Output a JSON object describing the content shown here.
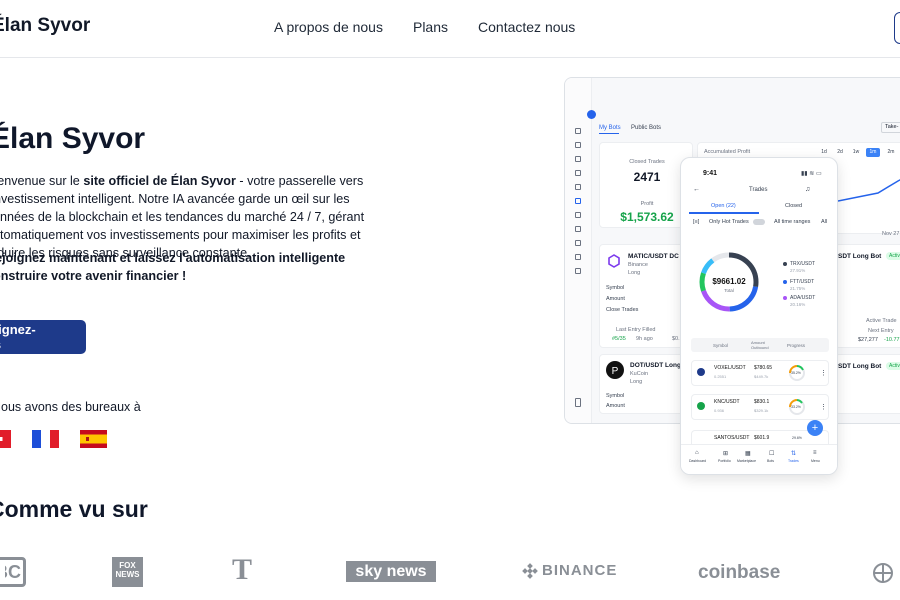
{
  "header": {
    "brand": "Élan Syvor",
    "nav": [
      "A propos de nous",
      "Plans",
      "Contactez nous"
    ]
  },
  "hero": {
    "title": "Élan Syvor",
    "desc_pre": "Bienvenue sur le ",
    "desc_bold": "site officiel de Élan Syvor",
    "desc_post": " - votre passerelle vers l'investissement intelligent. Notre IA avancée garde un œil sur les données de la blockchain et les tendances du marché 24 / 7, gérant automatiquement vos investissements pour maximiser les profits et réduire les risques sans surveillance constante.",
    "cta_text": "Rejoignez maintenant et laissez l'automatisation intelligente construire votre avenir financier !",
    "join_button": "Rejoignez-nous",
    "offices": "Nous avons des bureaux à"
  },
  "seen_title": "Comme vu sur",
  "logos": [
    "CNBC",
    "FOX NEWS",
    "T",
    "sky news",
    "BINANCE",
    "coinbase"
  ],
  "dashboard": {
    "tabs": [
      "My Bots",
      "Public Bots"
    ],
    "take_btn": "Take-",
    "closed_trades_label": "Closed Trades",
    "closed_trades_value": "2471",
    "profit_label": "Profit",
    "profit_value": "$1,573.62",
    "accumulated": "Accumulated Profit",
    "ranges": [
      "1d",
      "2d",
      "1w",
      "1m",
      "2m"
    ],
    "bot1": {
      "pair": "MATIC/USDT DC",
      "exchange": "Binance",
      "side": "Long",
      "symbol": "Symbol",
      "amount": "Amount",
      "close": "Close Trades",
      "last_entry": "Last Entry Filled",
      "count": "#5/35",
      "ago": "9h ago",
      "val": "$0."
    },
    "bot2": {
      "pair": "DOT/USDT Long",
      "exchange": "KuCoin",
      "side": "Long",
      "symbol": "Symbol",
      "amount": "Amount"
    },
    "right1": {
      "pair": "SDT Long Bot",
      "active": "Activ",
      "active_trade": "Active Trade",
      "next_entry": "Next Entry",
      "val": "$27,277",
      "pct": "-10.77"
    },
    "right2": {
      "pair": "SDT Long Bot",
      "active": "Activ"
    },
    "nov": "Nov 27"
  },
  "phone": {
    "time": "9:41",
    "title": "Trades",
    "tab_open": "Open (22)",
    "tab_closed": "Closed",
    "only_hot": "Only Hot Trades",
    "all_time": "All time ranges",
    "all": "All",
    "total_value": "$9661.02",
    "total_label": "Total",
    "legend": [
      {
        "name": "TRX/USDT",
        "pct": "27.91%",
        "color": "#374151"
      },
      {
        "name": "FTT/USDT",
        "pct": "21.75%",
        "color": "#2563eb"
      },
      {
        "name": "ADA/USDT",
        "pct": "20.16%",
        "color": "#a855f7"
      }
    ],
    "col_symbol": "Symbol",
    "col_amount": "Amount Outbound",
    "col_progress": "Progress",
    "rows": [
      {
        "pair": "VOXEL/USDT",
        "sub": "0.2551",
        "price": "$780.65",
        "sub2": "$449.7k",
        "pct": "35.2%"
      },
      {
        "pair": "KNC/USDT",
        "sub": "0.936",
        "price": "$830.1",
        "sub2": "$329.1k",
        "pct": "33.2%"
      },
      {
        "pair": "SANTOS/USDT",
        "sub": "",
        "price": "$601.9",
        "sub2": "",
        "pct": "29.6%"
      }
    ],
    "bottom_nav": [
      "Dashboard",
      "Portfolio",
      "Marketplace",
      "Bots",
      "Trades",
      "Menu"
    ]
  },
  "colors": {
    "accent": "#1e3a8a",
    "profit": "#16a34a",
    "button_blue": "#3b82f6"
  }
}
